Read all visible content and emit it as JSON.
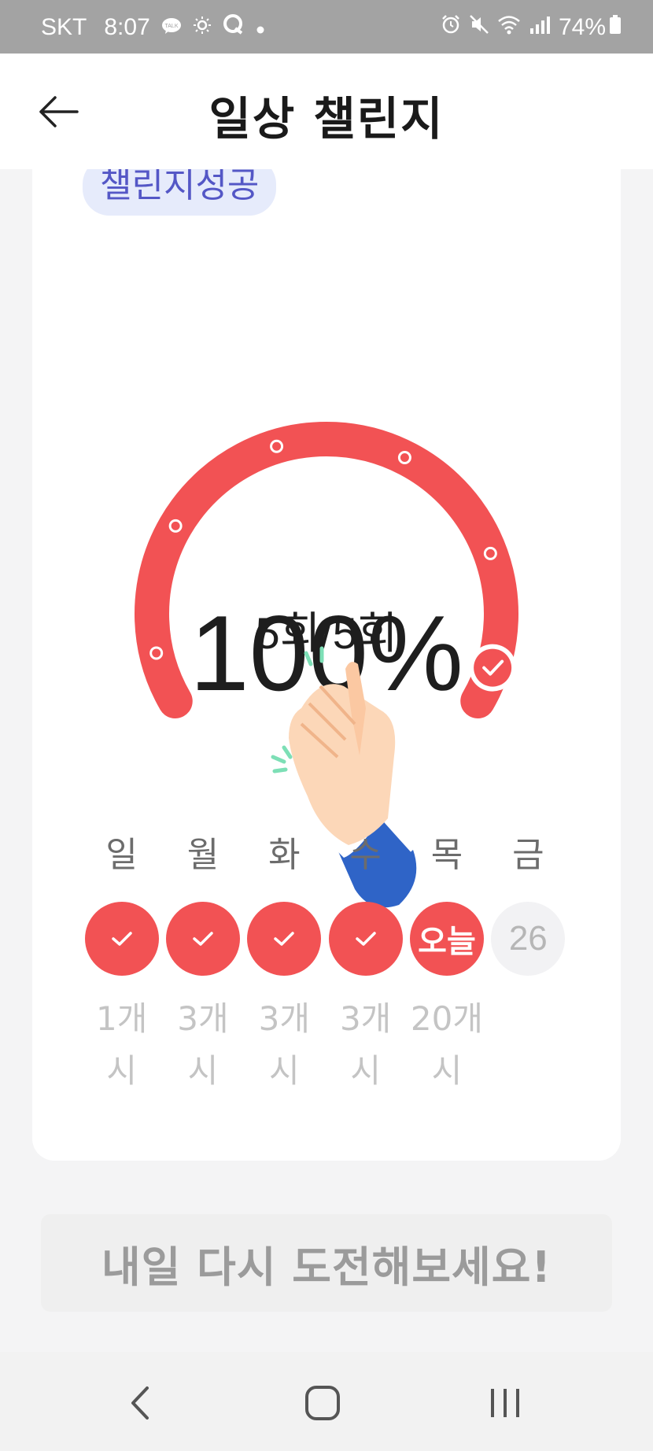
{
  "status_bar": {
    "carrier": "SKT",
    "time": "8:07",
    "talk_label": "TALK",
    "battery": "74%"
  },
  "header": {
    "title": "일상 챌린지"
  },
  "card": {
    "badge": "챌린지성공",
    "progress_text": "100%",
    "progress_value": 1.0,
    "count_text": "5회/5회",
    "milestones": 6
  },
  "week": {
    "days": [
      {
        "name": "일",
        "state": "done",
        "count": "1개시"
      },
      {
        "name": "월",
        "state": "done",
        "count": "3개시"
      },
      {
        "name": "화",
        "state": "done",
        "count": "3개시"
      },
      {
        "name": "수",
        "state": "done",
        "count": "3개시"
      },
      {
        "name": "목",
        "state": "today",
        "label": "오늘",
        "count": "20개시"
      },
      {
        "name": "금",
        "state": "future",
        "label": "26",
        "count": ""
      }
    ]
  },
  "cta": {
    "label": "내일 다시 도전해보세요!"
  },
  "colors": {
    "accent": "#f25254",
    "badge_bg": "#e6ebfb",
    "badge_text": "#5457c6"
  },
  "icons": {
    "back": "arrow-left-icon",
    "check": "check-icon",
    "clap": "clapping-hands-icon",
    "nav_back": "chevron-left-icon",
    "nav_home": "home-icon",
    "nav_recents": "recents-icon"
  }
}
